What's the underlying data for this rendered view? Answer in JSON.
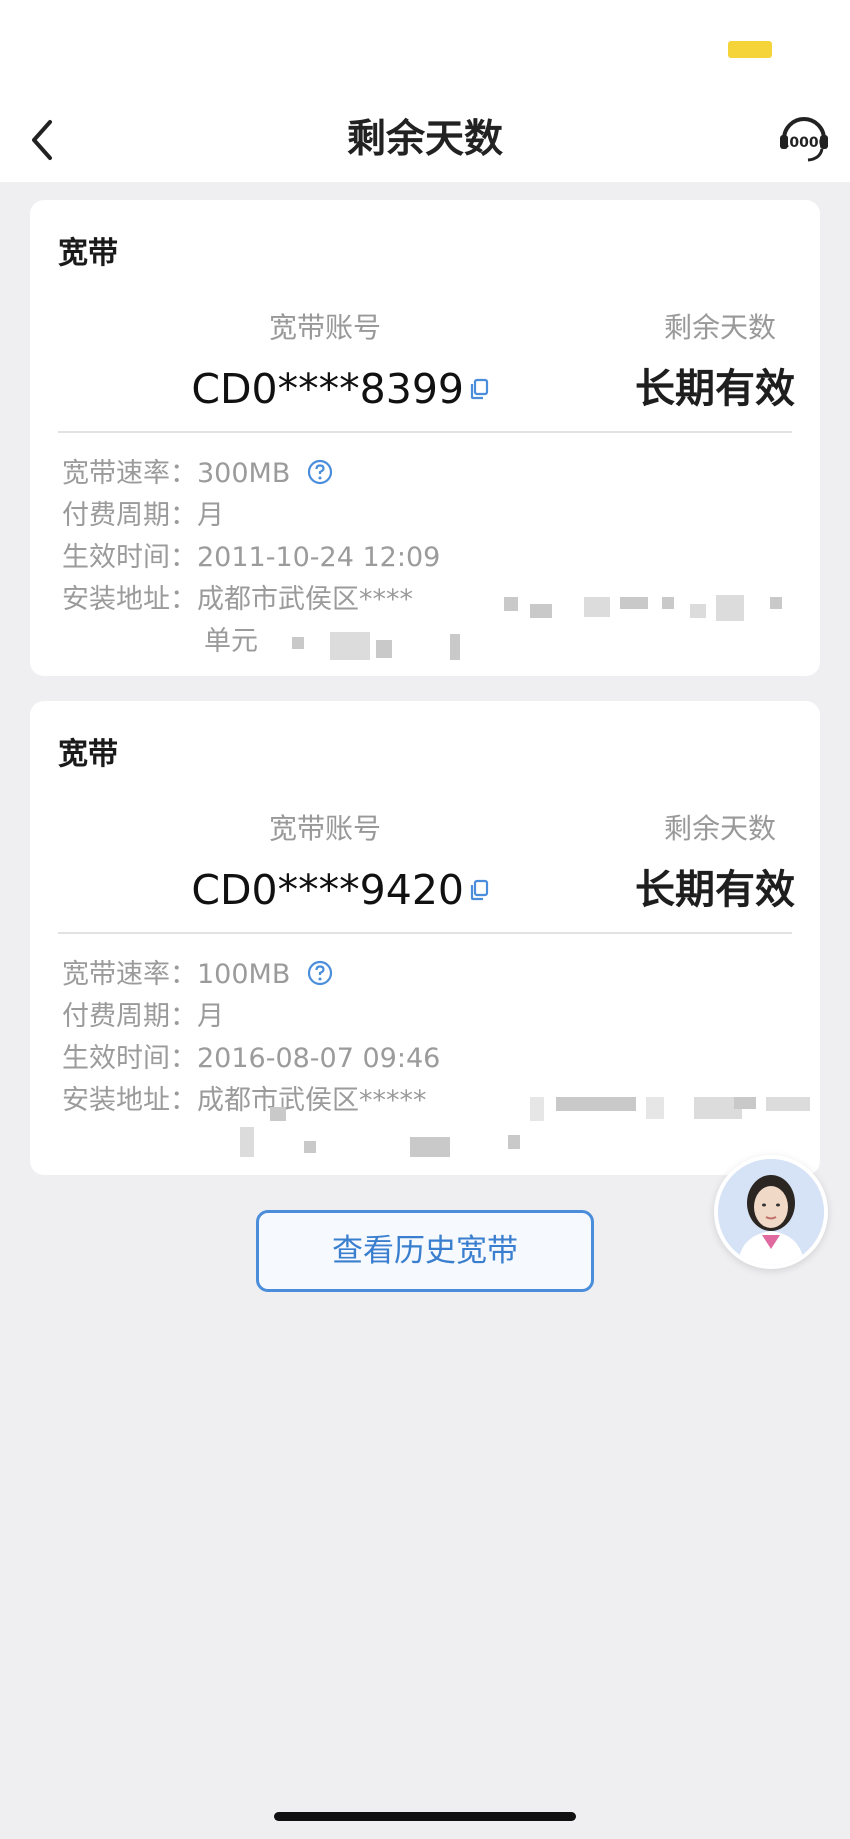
{
  "header": {
    "title": "剩余天数",
    "service_icon_text": "10000"
  },
  "cards": [
    {
      "title": "宽带",
      "account_label": "宽带账号",
      "account_value": "CD0****8399",
      "days_label": "剩余天数",
      "days_value": "长期有效",
      "speed_label": "宽带速率：",
      "speed_value": "300MB",
      "cycle_label": "付费周期：",
      "cycle_value": "月",
      "effective_label": "生效时间：",
      "effective_value": "2011-10-24 12:09",
      "address_label": "安装地址：",
      "address_value": "成都市武侯区****",
      "address_line2": "单元"
    },
    {
      "title": "宽带",
      "account_label": "宽带账号",
      "account_value": "CD0****9420",
      "days_label": "剩余天数",
      "days_value": "长期有效",
      "speed_label": "宽带速率：",
      "speed_value": "100MB",
      "cycle_label": "付费周期：",
      "cycle_value": "月",
      "effective_label": "生效时间：",
      "effective_value": "2016-08-07 09:46",
      "address_label": "安装地址：",
      "address_value": "成都市武侯区*****"
    }
  ],
  "history_button": "查看历史宽带",
  "colors": {
    "accent": "#4a8ddb",
    "battery": "#f5d43a",
    "background": "#efeff1"
  }
}
